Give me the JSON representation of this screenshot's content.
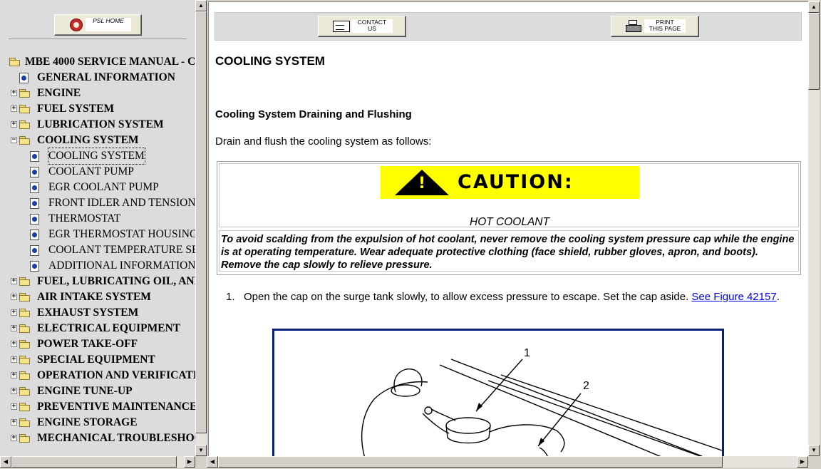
{
  "left_frame": {
    "home_button": {
      "label": "PSL HOME",
      "icon": "home-icon"
    },
    "tree": {
      "root": "MBE 4000 SERVICE MANUAL - C",
      "items": [
        {
          "label": "GENERAL INFORMATION",
          "kind": "doc",
          "bold": true
        },
        {
          "label": "ENGINE",
          "kind": "folder",
          "bold": true,
          "expander": "+"
        },
        {
          "label": "FUEL SYSTEM",
          "kind": "folder",
          "bold": true,
          "expander": "+"
        },
        {
          "label": "LUBRICATION SYSTEM",
          "kind": "folder",
          "bold": true,
          "expander": "+"
        },
        {
          "label": "COOLING SYSTEM",
          "kind": "folder-open",
          "bold": true,
          "expander": "−"
        },
        {
          "label": "COOLING SYSTEM",
          "kind": "doc",
          "child": true,
          "selected": true
        },
        {
          "label": "COOLANT PUMP",
          "kind": "doc",
          "child": true
        },
        {
          "label": "EGR COOLANT PUMP",
          "kind": "doc",
          "child": true
        },
        {
          "label": "FRONT IDLER AND TENSIONER",
          "kind": "doc",
          "child": true
        },
        {
          "label": "THERMOSTAT",
          "kind": "doc",
          "child": true
        },
        {
          "label": "EGR THERMOSTAT HOUSING",
          "kind": "doc",
          "child": true
        },
        {
          "label": "COOLANT TEMPERATURE SENSOR",
          "kind": "doc",
          "child": true
        },
        {
          "label": "ADDITIONAL INFORMATION",
          "kind": "doc",
          "child": true
        },
        {
          "label": "FUEL, LUBRICATING OIL, AND COOLANT",
          "kind": "folder",
          "bold": true,
          "expander": "+"
        },
        {
          "label": "AIR INTAKE SYSTEM",
          "kind": "folder",
          "bold": true,
          "expander": "+"
        },
        {
          "label": "EXHAUST SYSTEM",
          "kind": "folder",
          "bold": true,
          "expander": "+"
        },
        {
          "label": "ELECTRICAL EQUIPMENT",
          "kind": "folder",
          "bold": true,
          "expander": "+"
        },
        {
          "label": "POWER TAKE-OFF",
          "kind": "folder",
          "bold": true,
          "expander": "+"
        },
        {
          "label": "SPECIAL EQUIPMENT",
          "kind": "folder",
          "bold": true,
          "expander": "+"
        },
        {
          "label": "OPERATION AND VERIFICATION",
          "kind": "folder",
          "bold": true,
          "expander": "+"
        },
        {
          "label": "ENGINE TUNE-UP",
          "kind": "folder",
          "bold": true,
          "expander": "+"
        },
        {
          "label": "PREVENTIVE MAINTENANCE",
          "kind": "folder",
          "bold": true,
          "expander": "+"
        },
        {
          "label": "ENGINE STORAGE",
          "kind": "folder",
          "bold": true,
          "expander": "+"
        },
        {
          "label": "MECHANICAL TROUBLESHOOTING",
          "kind": "folder",
          "bold": true,
          "expander": "+"
        }
      ]
    }
  },
  "toolbar": {
    "contact_label_1": "CONTACT",
    "contact_label_2": "US",
    "contact_icon": "envelope-icon",
    "print_label_1": "PRINT",
    "print_label_2": "THIS PAGE",
    "print_icon": "printer-icon"
  },
  "main": {
    "title": "COOLING SYSTEM",
    "section_heading": "Cooling System Draining and Flushing",
    "intro": "Drain and flush the cooling system as follows:",
    "caution": {
      "banner": "CAUTION:",
      "subtitle": "HOT COOLANT",
      "text": "To avoid scalding from the expulsion of hot coolant, never remove the cooling system pressure cap while the engine is at operating temperature. Wear adequate protective clothing (face shield, rubber gloves, apron, and boots). Remove the cap slowly to relieve pressure."
    },
    "steps": [
      {
        "number": "1.",
        "text": "Open the cap on the surge tank slowly, to allow excess pressure to escape. Set the cap aside.",
        "link": "See Figure 42157",
        "after": "."
      }
    ],
    "figure": {
      "callout_1": "1",
      "callout_2": "2"
    }
  },
  "colors": {
    "figure_border": "#0b1e7a",
    "caution_yellow": "#ffff00",
    "link": "#0000ee"
  }
}
